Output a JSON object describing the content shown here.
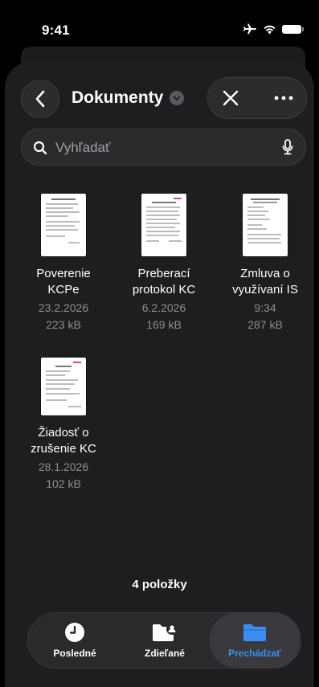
{
  "status_bar": {
    "time": "9:41"
  },
  "header": {
    "title": "Dokumenty"
  },
  "search": {
    "placeholder": "Vyhľadať"
  },
  "files": [
    {
      "name_line1": "Poverenie",
      "name_line2": "KCPe",
      "date": "23.2.2026",
      "size": "223 kB"
    },
    {
      "name_line1": "Preberací",
      "name_line2": "protokol KC",
      "date": "6.2.2026",
      "size": "169 kB"
    },
    {
      "name_line1": "Zmluva o",
      "name_line2": "využívaní IS",
      "date": "9:34",
      "size": "287 kB"
    },
    {
      "name_line1": "Žiadosť o",
      "name_line2": "zrušenie KC",
      "date": "28.1.2026",
      "size": "102 kB"
    }
  ],
  "footer": {
    "count": "4 položky"
  },
  "tabbar": {
    "tabs": [
      {
        "label": "Posledné",
        "icon": "clock-icon"
      },
      {
        "label": "Zdieľané",
        "icon": "shared-folder-icon"
      },
      {
        "label": "Prechádzať",
        "icon": "folder-icon"
      }
    ],
    "active_color": "#3a8ff0"
  }
}
